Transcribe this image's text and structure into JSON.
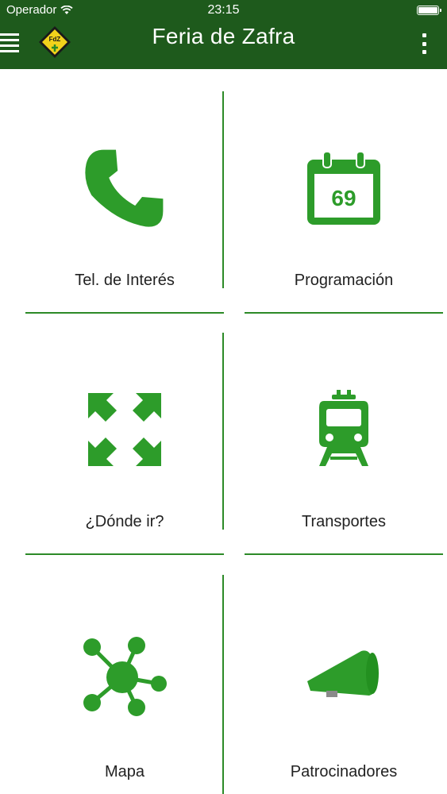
{
  "status_bar": {
    "carrier": "Operador",
    "time": "23:15"
  },
  "app_bar": {
    "title": "Feria de Zafra",
    "logo_text": "FdZ",
    "menu_icon": "hamburger-menu-icon",
    "overflow_icon": "more-vertical-icon"
  },
  "colors": {
    "app_bar": "#1e5a1c",
    "accent": "#2c8a27",
    "icon_green": "#2d9c2a"
  },
  "menu": {
    "items": [
      {
        "label": "Tel. de Interés",
        "icon": "phone-icon"
      },
      {
        "label": "Programación",
        "icon": "calendar-icon",
        "icon_text": "69"
      },
      {
        "label": "¿Dónde ir?",
        "icon": "expand-arrows-icon"
      },
      {
        "label": "Transportes",
        "icon": "train-icon"
      },
      {
        "label": "Mapa",
        "icon": "network-nodes-icon"
      },
      {
        "label": "Patrocinadores",
        "icon": "megaphone-icon"
      }
    ]
  }
}
